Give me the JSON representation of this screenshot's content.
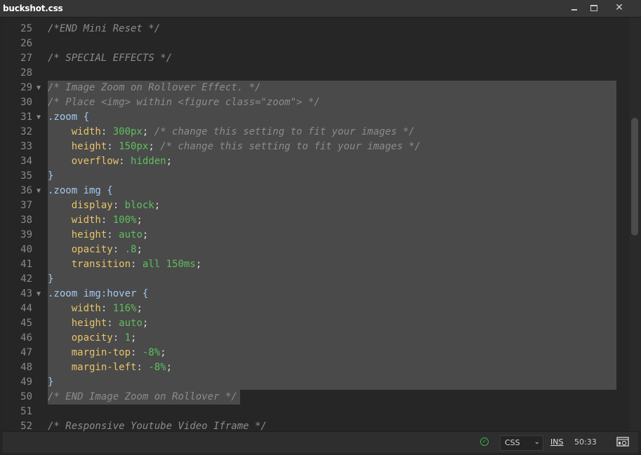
{
  "window": {
    "title": "buckshot.css",
    "minimize_icon": "minimize-icon",
    "maximize_icon": "maximize-icon",
    "close_icon": "close-icon"
  },
  "editor": {
    "lines": [
      {
        "num": "25",
        "fold": false,
        "selected": false,
        "tokens": [
          {
            "t": "/*END Mini Reset */",
            "c": "comment"
          }
        ]
      },
      {
        "num": "26",
        "fold": false,
        "selected": false,
        "tokens": []
      },
      {
        "num": "27",
        "fold": false,
        "selected": false,
        "tokens": [
          {
            "t": "/* SPECIAL EFFECTS */",
            "c": "comment"
          }
        ]
      },
      {
        "num": "28",
        "fold": false,
        "selected": false,
        "tokens": []
      },
      {
        "num": "29",
        "fold": true,
        "selected": true,
        "tokens": [
          {
            "t": "/* Image Zoom on Rollover Effect. */",
            "c": "comment"
          }
        ]
      },
      {
        "num": "30",
        "fold": false,
        "selected": true,
        "tokens": [
          {
            "t": "/* Place <img> within <figure class=\"zoom\"> */",
            "c": "comment"
          }
        ]
      },
      {
        "num": "31",
        "fold": true,
        "selected": true,
        "tokens": [
          {
            "t": ".zoom",
            "c": "sel"
          },
          {
            "t": " {",
            "c": "sel"
          }
        ]
      },
      {
        "num": "32",
        "fold": false,
        "selected": true,
        "tokens": [
          {
            "t": "    width",
            "c": "prop"
          },
          {
            "t": ": ",
            "c": "punc"
          },
          {
            "t": "300px",
            "c": "val"
          },
          {
            "t": "; ",
            "c": "punc"
          },
          {
            "t": "/* change this setting to fit your images */",
            "c": "comment"
          }
        ]
      },
      {
        "num": "33",
        "fold": false,
        "selected": true,
        "tokens": [
          {
            "t": "    height",
            "c": "prop"
          },
          {
            "t": ": ",
            "c": "punc"
          },
          {
            "t": "150px",
            "c": "val"
          },
          {
            "t": "; ",
            "c": "punc"
          },
          {
            "t": "/* change this setting to fit your images */",
            "c": "comment"
          }
        ]
      },
      {
        "num": "34",
        "fold": false,
        "selected": true,
        "tokens": [
          {
            "t": "    overflow",
            "c": "prop"
          },
          {
            "t": ": ",
            "c": "punc"
          },
          {
            "t": "hidden",
            "c": "val"
          },
          {
            "t": ";",
            "c": "punc"
          }
        ]
      },
      {
        "num": "35",
        "fold": false,
        "selected": true,
        "tokens": [
          {
            "t": "}",
            "c": "sel"
          }
        ]
      },
      {
        "num": "36",
        "fold": true,
        "selected": true,
        "tokens": [
          {
            "t": ".zoom img",
            "c": "sel"
          },
          {
            "t": " {",
            "c": "sel"
          }
        ]
      },
      {
        "num": "37",
        "fold": false,
        "selected": true,
        "tokens": [
          {
            "t": "    display",
            "c": "prop"
          },
          {
            "t": ": ",
            "c": "punc"
          },
          {
            "t": "block",
            "c": "val"
          },
          {
            "t": ";",
            "c": "punc"
          }
        ]
      },
      {
        "num": "38",
        "fold": false,
        "selected": true,
        "tokens": [
          {
            "t": "    width",
            "c": "prop"
          },
          {
            "t": ": ",
            "c": "punc"
          },
          {
            "t": "100%",
            "c": "val"
          },
          {
            "t": ";",
            "c": "punc"
          }
        ]
      },
      {
        "num": "39",
        "fold": false,
        "selected": true,
        "tokens": [
          {
            "t": "    height",
            "c": "prop"
          },
          {
            "t": ": ",
            "c": "punc"
          },
          {
            "t": "auto",
            "c": "val"
          },
          {
            "t": ";",
            "c": "punc"
          }
        ]
      },
      {
        "num": "40",
        "fold": false,
        "selected": true,
        "tokens": [
          {
            "t": "    opacity",
            "c": "prop"
          },
          {
            "t": ": ",
            "c": "punc"
          },
          {
            "t": ".8",
            "c": "val"
          },
          {
            "t": ";",
            "c": "punc"
          }
        ]
      },
      {
        "num": "41",
        "fold": false,
        "selected": true,
        "tokens": [
          {
            "t": "    transition",
            "c": "prop"
          },
          {
            "t": ": ",
            "c": "punc"
          },
          {
            "t": "all 150ms",
            "c": "val"
          },
          {
            "t": ";",
            "c": "punc"
          }
        ]
      },
      {
        "num": "42",
        "fold": false,
        "selected": true,
        "tokens": [
          {
            "t": "}",
            "c": "sel"
          }
        ]
      },
      {
        "num": "43",
        "fold": true,
        "selected": true,
        "tokens": [
          {
            "t": ".zoom img:hover",
            "c": "sel"
          },
          {
            "t": " {",
            "c": "sel"
          }
        ]
      },
      {
        "num": "44",
        "fold": false,
        "selected": true,
        "tokens": [
          {
            "t": "    width",
            "c": "prop"
          },
          {
            "t": ": ",
            "c": "punc"
          },
          {
            "t": "116%",
            "c": "val"
          },
          {
            "t": ";",
            "c": "punc"
          }
        ]
      },
      {
        "num": "45",
        "fold": false,
        "selected": true,
        "tokens": [
          {
            "t": "    height",
            "c": "prop"
          },
          {
            "t": ": ",
            "c": "punc"
          },
          {
            "t": "auto",
            "c": "val"
          },
          {
            "t": ";",
            "c": "punc"
          }
        ]
      },
      {
        "num": "46",
        "fold": false,
        "selected": true,
        "tokens": [
          {
            "t": "    opacity",
            "c": "prop"
          },
          {
            "t": ": ",
            "c": "punc"
          },
          {
            "t": "1",
            "c": "val"
          },
          {
            "t": ";",
            "c": "punc"
          }
        ]
      },
      {
        "num": "47",
        "fold": false,
        "selected": true,
        "tokens": [
          {
            "t": "    margin-top",
            "c": "prop"
          },
          {
            "t": ": ",
            "c": "punc"
          },
          {
            "t": "-8%",
            "c": "val"
          },
          {
            "t": ";",
            "c": "punc"
          }
        ]
      },
      {
        "num": "48",
        "fold": false,
        "selected": true,
        "tokens": [
          {
            "t": "    margin-left",
            "c": "prop"
          },
          {
            "t": ": ",
            "c": "punc"
          },
          {
            "t": "-8%",
            "c": "val"
          },
          {
            "t": ";",
            "c": "punc"
          }
        ]
      },
      {
        "num": "49",
        "fold": false,
        "selected": true,
        "tokens": [
          {
            "t": "}",
            "c": "sel"
          }
        ]
      },
      {
        "num": "50",
        "fold": false,
        "selected": "partial",
        "tokens": [
          {
            "t": "/* END Image Zoom on Rollover */",
            "c": "comment"
          }
        ]
      },
      {
        "num": "51",
        "fold": false,
        "selected": false,
        "tokens": []
      },
      {
        "num": "52",
        "fold": false,
        "selected": false,
        "tokens": [
          {
            "t": "/* Responsive Youtube Video Iframe */",
            "c": "comment"
          }
        ]
      }
    ],
    "colors": {
      "background": "#262626",
      "selection": "#4a4a4a",
      "comment": "#8c8c8c",
      "selector": "#a4c8f0",
      "property": "#e8c46a",
      "value": "#5fbf5f"
    }
  },
  "statusbar": {
    "status_icon": "check-circle-icon",
    "language": "CSS",
    "mode": "INS",
    "cursor_position": "50:33",
    "preview_icon": "live-preview-icon"
  }
}
